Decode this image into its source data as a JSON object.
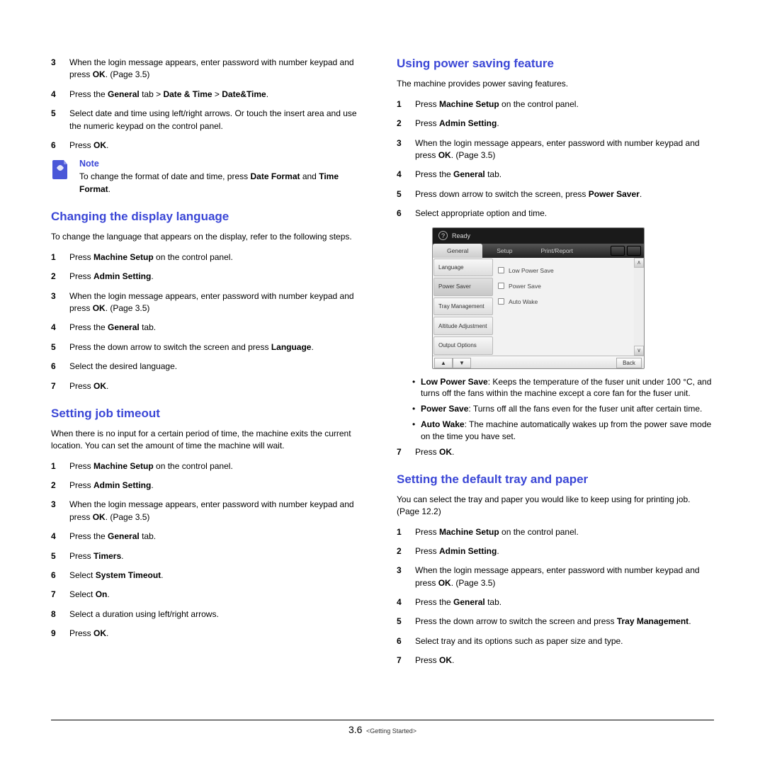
{
  "left": {
    "pre_steps": [
      {
        "n": "3",
        "html": "When the login message appears, enter password with number keypad and press <b>OK</b>. (Page 3.5)"
      },
      {
        "n": "4",
        "html": "Press the <b>General</b> tab > <b>Date & Time</b> > <b>Date&Time</b>."
      },
      {
        "n": "5",
        "html": "Select date and time using left/right arrows. Or touch the insert area and use the numeric keypad on the control panel."
      },
      {
        "n": "6",
        "html": "Press <b>OK</b>."
      }
    ],
    "note_title": "Note",
    "note_text": "To change the format of date and time, press <b>Date Format</b> and <b>Time Format</b>.",
    "h_lang": "Changing the display language",
    "lang_intro": "To change the language that appears on the display, refer to the following steps.",
    "lang_steps": [
      {
        "n": "1",
        "html": "Press <b>Machine Setup</b> on the control panel."
      },
      {
        "n": "2",
        "html": "Press <b>Admin Setting</b>."
      },
      {
        "n": "3",
        "html": "When the login message appears, enter password with number keypad and press <b>OK</b>. (Page 3.5)"
      },
      {
        "n": "4",
        "html": "Press the <b>General</b> tab."
      },
      {
        "n": "5",
        "html": "Press the down arrow to switch the screen and press <b>Language</b>."
      },
      {
        "n": "6",
        "html": "Select the desired language."
      },
      {
        "n": "7",
        "html": "Press <b>OK</b>."
      }
    ],
    "h_timeout": "Setting job timeout",
    "timeout_intro": "When there is no input for a certain period of time, the machine exits the current location. You can set the amount of time the machine will wait.",
    "timeout_steps": [
      {
        "n": "1",
        "html": "Press <b>Machine Setup</b> on the control panel."
      },
      {
        "n": "2",
        "html": "Press <b>Admin Setting</b>."
      },
      {
        "n": "3",
        "html": "When the login message appears, enter password with number keypad and press <b>OK</b>. (Page 3.5)"
      },
      {
        "n": "4",
        "html": "Press the <b>General</b> tab."
      },
      {
        "n": "5",
        "html": "Press <b>Timers</b>."
      },
      {
        "n": "6",
        "html": "Select <b>System Timeout</b>."
      },
      {
        "n": "7",
        "html": "Select <b>On</b>."
      },
      {
        "n": "8",
        "html": "Select a duration using left/right arrows."
      },
      {
        "n": "9",
        "html": "Press <b>OK</b>."
      }
    ]
  },
  "right": {
    "h_power": "Using power saving feature",
    "power_intro": "The machine provides power saving features.",
    "power_steps_a": [
      {
        "n": "1",
        "html": "Press <b>Machine Setup</b> on the control panel."
      },
      {
        "n": "2",
        "html": "Press <b>Admin Setting</b>."
      },
      {
        "n": "3",
        "html": "When the login message appears, enter password with number keypad and press <b>OK</b>. (Page 3.5)"
      },
      {
        "n": "4",
        "html": "Press the <b>General</b> tab."
      },
      {
        "n": "5",
        "html": "Press down arrow to switch the screen, press <b>Power Saver</b>."
      },
      {
        "n": "6",
        "html": "Select appropriate option and time."
      }
    ],
    "screenshot": {
      "status": "Ready",
      "tabs": [
        "General",
        "Setup",
        "Print/Report"
      ],
      "side": [
        "Language",
        "Power Saver",
        "Tray Management",
        "Altitude Adjustment",
        "Output Options"
      ],
      "options": [
        "Low Power Save",
        "Power Save",
        "Auto Wake"
      ],
      "back": "Back"
    },
    "power_bullets": [
      "<b>Low Power Save</b>: Keeps the temperature of the fuser unit under 100 °C, and turns off the fans within the machine except a core fan for the fuser unit.",
      "<b>Power Save</b>: Turns off all the fans even for the fuser unit after certain time.",
      "<b>Auto Wake</b>: The machine automatically wakes up from the power save mode on the time you have set."
    ],
    "power_steps_b": [
      {
        "n": "7",
        "html": "Press <b>OK</b>."
      }
    ],
    "h_tray": "Setting the default tray and paper",
    "tray_intro": "You can select the tray and paper you would like to keep using for printing job. (Page 12.2)",
    "tray_steps": [
      {
        "n": "1",
        "html": "Press <b>Machine Setup</b> on the control panel."
      },
      {
        "n": "2",
        "html": "Press <b>Admin Setting</b>."
      },
      {
        "n": "3",
        "html": "When the login message appears, enter password with number keypad and press <b>OK</b>. (Page 3.5)"
      },
      {
        "n": "4",
        "html": "Press the <b>General</b> tab."
      },
      {
        "n": "5",
        "html": "Press the down arrow to switch the screen and press <b>Tray Management</b>."
      },
      {
        "n": "6",
        "html": "Select tray and its options such as paper size and type."
      },
      {
        "n": "7",
        "html": "Press <b>OK</b>."
      }
    ]
  },
  "footer": {
    "chapter": "3",
    "sep": ".",
    "page": "6",
    "section": "<Getting Started>"
  }
}
